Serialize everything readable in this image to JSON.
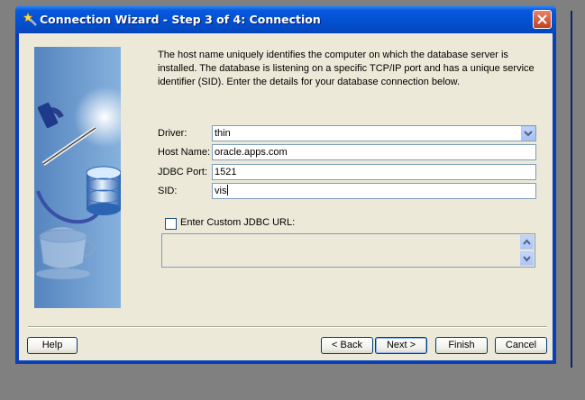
{
  "window": {
    "title": "Connection Wizard - Step 3 of 4: Connection",
    "title_icon": "wizard-wand-icon",
    "close_icon": "close-icon"
  },
  "content": {
    "description": "The host name uniquely identifies the computer on which the database server is installed.  The database is listening on a specific TCP/IP port and has a unique service identifier (SID).  Enter the details for your database connection below.",
    "side_image": "database-connection-illustration"
  },
  "form": {
    "driver": {
      "label": "Driver:",
      "value": "thin"
    },
    "host": {
      "label": "Host Name:",
      "value": "oracle.apps.com"
    },
    "port": {
      "label": "JDBC Port:",
      "value": "1521"
    },
    "sid": {
      "label": "SID:",
      "value": "vis"
    },
    "custom_url": {
      "label": "Enter Custom JDBC URL:",
      "checked": false,
      "value": ""
    }
  },
  "buttons": {
    "help": "Help",
    "back": "< Back",
    "next": "Next >",
    "finish": "Finish",
    "cancel": "Cancel"
  },
  "colors": {
    "title_bar": "#0350d0",
    "window_border": "#0a3fb8",
    "dialog_bg": "#ece9d8",
    "field_border": "#7f9db9",
    "desktop": "#808080"
  }
}
